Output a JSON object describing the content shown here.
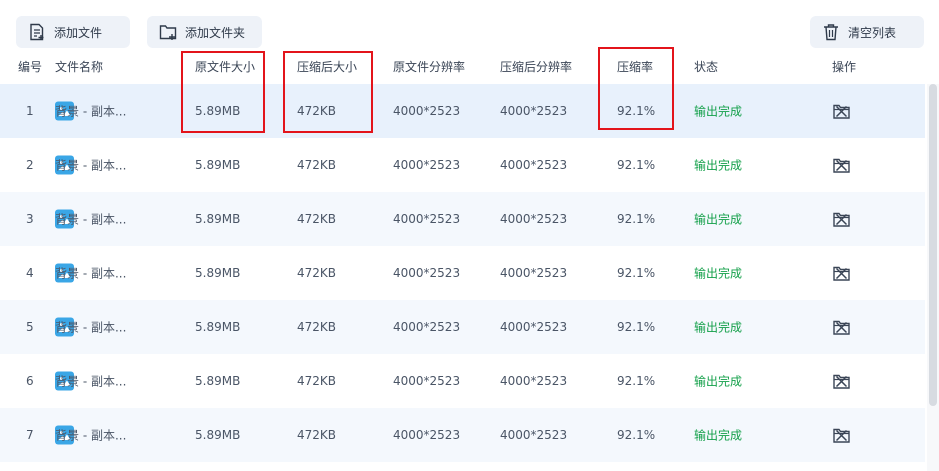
{
  "toolbar": {
    "add_file_label": "添加文件",
    "add_folder_label": "添加文件夹",
    "clear_list_label": "清空列表"
  },
  "table": {
    "headers": {
      "index": "编号",
      "name": "文件名称",
      "original_size": "原文件大小",
      "compressed_size": "压缩后大小",
      "original_resolution": "原文件分辨率",
      "compressed_resolution": "压缩后分辨率",
      "ratio": "压缩率",
      "status": "状态",
      "actions": "操作"
    },
    "rows": [
      {
        "index": "1",
        "name": "背景 - 副本...",
        "original_size": "5.89MB",
        "compressed_size": "472KB",
        "original_resolution": "4000*2523",
        "compressed_resolution": "4000*2523",
        "ratio": "92.1%",
        "status": "输出完成"
      },
      {
        "index": "2",
        "name": "背景 - 副本...",
        "original_size": "5.89MB",
        "compressed_size": "472KB",
        "original_resolution": "4000*2523",
        "compressed_resolution": "4000*2523",
        "ratio": "92.1%",
        "status": "输出完成"
      },
      {
        "index": "3",
        "name": "背景 - 副本...",
        "original_size": "5.89MB",
        "compressed_size": "472KB",
        "original_resolution": "4000*2523",
        "compressed_resolution": "4000*2523",
        "ratio": "92.1%",
        "status": "输出完成"
      },
      {
        "index": "4",
        "name": "背景 - 副本...",
        "original_size": "5.89MB",
        "compressed_size": "472KB",
        "original_resolution": "4000*2523",
        "compressed_resolution": "4000*2523",
        "ratio": "92.1%",
        "status": "输出完成"
      },
      {
        "index": "5",
        "name": "背景 - 副本...",
        "original_size": "5.89MB",
        "compressed_size": "472KB",
        "original_resolution": "4000*2523",
        "compressed_resolution": "4000*2523",
        "ratio": "92.1%",
        "status": "输出完成"
      },
      {
        "index": "6",
        "name": "背景 - 副本...",
        "original_size": "5.89MB",
        "compressed_size": "472KB",
        "original_resolution": "4000*2523",
        "compressed_resolution": "4000*2523",
        "ratio": "92.1%",
        "status": "输出完成"
      },
      {
        "index": "7",
        "name": "背景 - 副本...",
        "original_size": "5.89MB",
        "compressed_size": "472KB",
        "original_resolution": "4000*2523",
        "compressed_resolution": "4000*2523",
        "ratio": "92.1%",
        "status": "输出完成"
      }
    ]
  },
  "icons": {
    "add_file": "file-plus-icon",
    "add_folder": "folder-plus-icon",
    "clear": "trash-icon",
    "thumbnail": "image-icon",
    "open": "folder-icon",
    "remove": "close-icon"
  },
  "colors": {
    "status_done": "#14a04a",
    "highlight": "#e3141b",
    "thumbnail": "#3aa6e6",
    "selected_row": "#e8f1fc"
  }
}
